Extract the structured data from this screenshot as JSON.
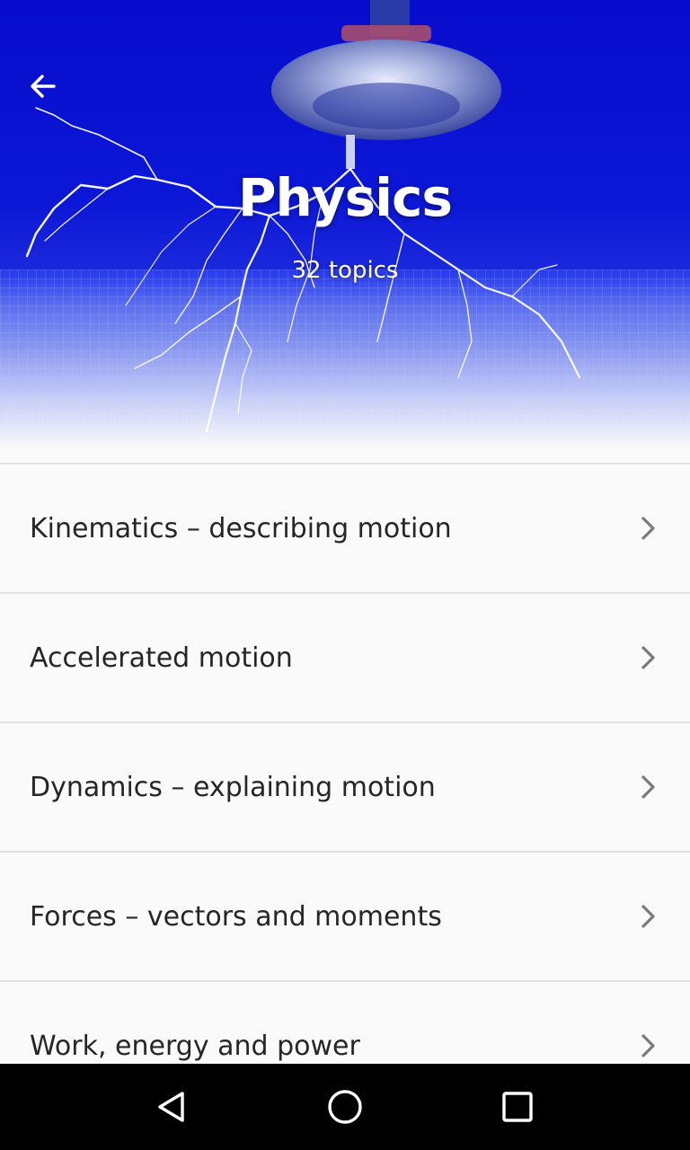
{
  "header": {
    "title": "Physics",
    "subtitle": "32 topics",
    "back_icon": "arrow-left-icon",
    "background_image": "tesla-coil-lightning",
    "accent_color": "#1020e8"
  },
  "topics": [
    {
      "label": "Kinematics – describing motion",
      "icon": "chevron-right-icon"
    },
    {
      "label": "Accelerated motion",
      "icon": "chevron-right-icon"
    },
    {
      "label": "Dynamics – explaining motion",
      "icon": "chevron-right-icon"
    },
    {
      "label": "Forces – vectors and moments",
      "icon": "chevron-right-icon"
    },
    {
      "label": "Work, energy and power",
      "icon": "chevron-right-icon"
    }
  ],
  "navigation_bar": {
    "back": "triangle-back-icon",
    "home": "circle-home-icon",
    "recents": "square-recents-icon"
  }
}
